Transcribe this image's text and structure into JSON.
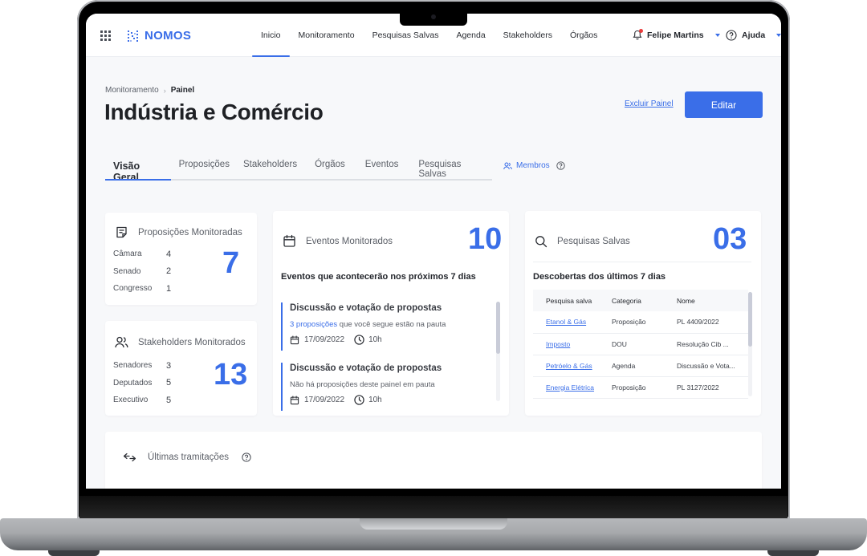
{
  "app": {
    "logo_text": "NOMOS",
    "brand_color": "#3a6ee8"
  },
  "nav": {
    "items": [
      {
        "label": "Inicio",
        "active": true
      },
      {
        "label": "Monitoramento"
      },
      {
        "label": "Pesquisas Salvas"
      },
      {
        "label": "Agenda"
      },
      {
        "label": "Stakeholders"
      },
      {
        "label": "Órgãos"
      }
    ],
    "user_name": "Felipe Martins",
    "help_label": "Ajuda"
  },
  "breadcrumb": {
    "parent": "Monitoramento",
    "current": "Painel"
  },
  "page": {
    "title": "Indústria e Comércio",
    "delete_label": "Excluir Painel",
    "edit_label": "Editar"
  },
  "tabs": {
    "items": [
      {
        "label": "Visão Geral",
        "active": true
      },
      {
        "label": "Proposições"
      },
      {
        "label": "Stakeholders"
      },
      {
        "label": "Órgãos"
      },
      {
        "label": "Eventos"
      },
      {
        "label": "Pesquisas Salvas"
      }
    ],
    "members_label": "Membros"
  },
  "proposicoes": {
    "title": "Proposições Monitoradas",
    "total": "7",
    "rows": [
      {
        "label": "Câmara",
        "value": "4"
      },
      {
        "label": "Senado",
        "value": "2"
      },
      {
        "label": "Congresso",
        "value": "1"
      }
    ]
  },
  "stakeholders": {
    "title": "Stakeholders Monitorados",
    "total": "13",
    "rows": [
      {
        "label": "Senadores",
        "value": "3"
      },
      {
        "label": "Deputados",
        "value": "5"
      },
      {
        "label": "Executivo",
        "value": "5"
      }
    ]
  },
  "eventos": {
    "title": "Eventos Monitorados",
    "total": "10",
    "subtitle": "Eventos que acontecerão nos próximos 7 dias",
    "items": [
      {
        "title": "Discussão e votação de propostas",
        "highlight": "3 proposições",
        "desc": " que você segue estão na pauta",
        "date": "17/09/2022",
        "time": "10h"
      },
      {
        "title": "Discussão e votação de propostas",
        "highlight": "",
        "desc": "Não há proposições deste painel em pauta",
        "date": "17/09/2022",
        "time": "10h"
      }
    ]
  },
  "pesquisas": {
    "title": "Pesquisas Salvas",
    "total": "03",
    "subtitle": "Descobertas dos últimos 7 dias",
    "columns": [
      "Pesquisa salva",
      "Categoria",
      "Nome"
    ],
    "rows": [
      [
        "Etanol & Gás",
        "Proposição",
        "PL 4409/2022"
      ],
      [
        "Imposto",
        "DOU",
        "Resolução Cib ..."
      ],
      [
        "Petróelo & Gás",
        "Agenda",
        "Discussão e Vota..."
      ],
      [
        "Energia Elétrica",
        "Proposição",
        "PL 3127/2022"
      ]
    ]
  },
  "tramitacoes": {
    "title": "Últimas tramitações"
  }
}
